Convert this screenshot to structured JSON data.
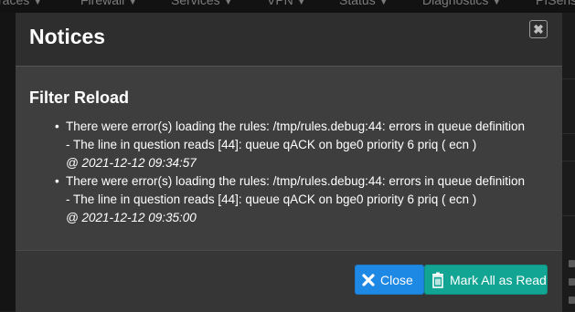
{
  "navbar": {
    "items": [
      "races",
      "Firewall",
      "Services",
      "VPN",
      "Status",
      "Diagnostics",
      "PfSens"
    ]
  },
  "modal": {
    "title": "Notices",
    "close_glyph": "✖",
    "section_title": "Filter Reload",
    "notices": [
      {
        "line1": "There were error(s) loading the rules: /tmp/rules.debug:44: errors in queue definition",
        "line2": "- The line in question reads [44]: queue qACK on bge0 priority 6 priq ( ecn )",
        "date": "@ 2021-12-12 09:34:57"
      },
      {
        "line1": "There were error(s) loading the rules: /tmp/rules.debug:44: errors in queue definition",
        "line2": "- The line in question reads [44]: queue qACK on bge0 priority 6 priq ( ecn )",
        "date": "@ 2021-12-12 09:35:00"
      }
    ],
    "footer": {
      "close_label": "Close",
      "mark_all_label": "Mark All as Read"
    }
  },
  "colors": {
    "close_button": "#1e88e5",
    "mark_all_button": "#12a594",
    "modal_body": "#3e3e3e",
    "modal_header": "#2e2e2e"
  }
}
